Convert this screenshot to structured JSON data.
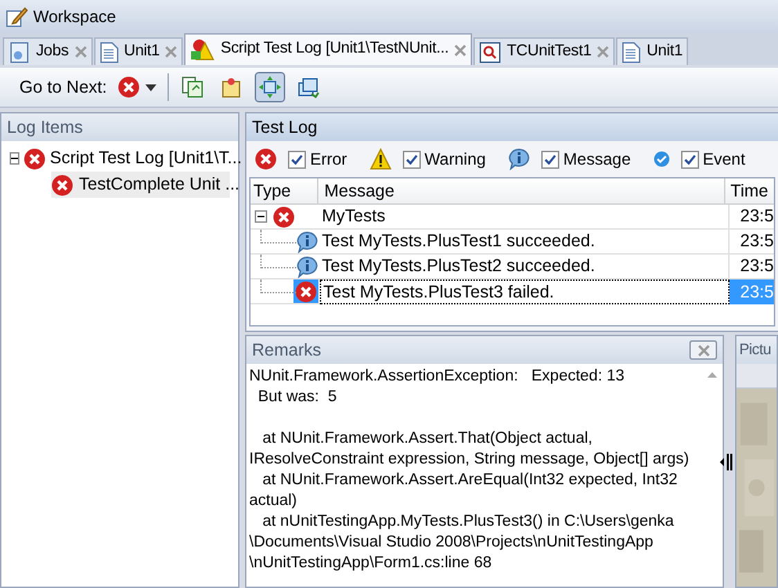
{
  "window": {
    "title": "Workspace"
  },
  "tabs": [
    {
      "label": "Jobs",
      "selected": false
    },
    {
      "label": "Unit1",
      "selected": false
    },
    {
      "label": "Script Test Log [Unit1\\TestNUnit...",
      "selected": true
    },
    {
      "label": "TCUnitTest1",
      "selected": false
    },
    {
      "label": "Unit1",
      "selected": false
    }
  ],
  "toolbar": {
    "label": "Go to Next:",
    "buttons": [
      {
        "selected": false
      },
      {
        "selected": false
      },
      {
        "selected": true
      },
      {
        "selected": false
      }
    ]
  },
  "log_items": {
    "title": "Log Items",
    "tree": [
      {
        "label": "Script Test Log [Unit1\\T...",
        "expanded": true,
        "selected": false,
        "children": [
          {
            "label": "TestComplete Unit ...",
            "selected": true
          }
        ]
      }
    ]
  },
  "test_log": {
    "title": "Test Log",
    "filters": [
      {
        "kind": "error",
        "label": "Error",
        "checked": true
      },
      {
        "kind": "warning",
        "label": "Warning",
        "checked": true
      },
      {
        "kind": "message",
        "label": "Message",
        "checked": true
      },
      {
        "kind": "event",
        "label": "Event",
        "checked": true
      }
    ],
    "columns": [
      "Type",
      "Message",
      "Time"
    ],
    "rows": [
      {
        "kind": "error",
        "message": "MyTests",
        "time": "23:5",
        "selected": false,
        "expanded": true,
        "child": false
      },
      {
        "kind": "message",
        "message": "Test MyTests.PlusTest1 succeeded.",
        "time": "23:5",
        "selected": false,
        "child": true
      },
      {
        "kind": "message",
        "message": "Test MyTests.PlusTest2 succeeded.",
        "time": "23:5",
        "selected": false,
        "child": true
      },
      {
        "kind": "error",
        "message": "Test MyTests.PlusTest3 failed.",
        "time": "23:5",
        "selected": true,
        "child": true
      }
    ]
  },
  "remarks": {
    "title": "Remarks",
    "paragraphs": [
      [
        "NUnit.Framework.AssertionException:   Expected: 13",
        "  But was:  5"
      ],
      [
        "   at NUnit.Framework.Assert.That(Object actual,",
        "IResolveConstraint expression, String message, Object[] args)",
        "   at NUnit.Framework.Assert.AreEqual(Int32 expected, Int32",
        "actual)",
        "   at nUnitTestingApp.MyTests.PlusTest3() in C:\\Users\\genka",
        "\\Documents\\Visual Studio 2008\\Projects\\nUnitTestingApp",
        "\\nUnitTestingApp\\Form1.cs:line 68"
      ]
    ]
  },
  "picture_panel": {
    "title": "Pictu"
  }
}
